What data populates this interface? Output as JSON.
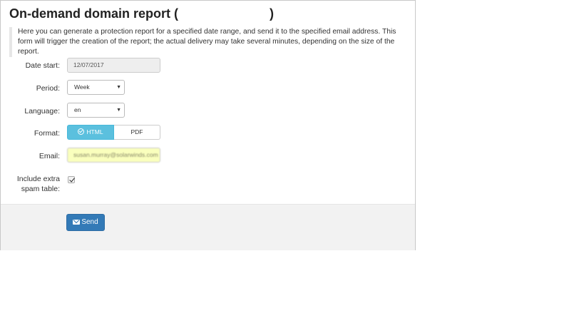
{
  "header": {
    "title_prefix": "On-demand domain report (",
    "title_suffix": ")"
  },
  "description": "Here you can generate a protection report for a specified date range, and send it to the specified email address. This form will trigger the creation of the report; the actual delivery may take several minutes, depending on the size of the report.",
  "form": {
    "date_start": {
      "label": "Date start:",
      "value": "12/07/2017"
    },
    "period": {
      "label": "Period:",
      "value": "Week"
    },
    "language": {
      "label": "Language:",
      "value": "en"
    },
    "format": {
      "label": "Format:",
      "options": [
        "HTML",
        "PDF"
      ],
      "selected": "HTML"
    },
    "email": {
      "label": "Email:",
      "value": "susan.murray@solarwinds.com"
    },
    "include_spam": {
      "label_line1": "Include extra",
      "label_line2": "spam table:",
      "checked": true
    }
  },
  "footer": {
    "send_label": "Send"
  },
  "colors": {
    "primary": "#337ab7",
    "info": "#5bc0de",
    "autofill": "#faffbd"
  }
}
